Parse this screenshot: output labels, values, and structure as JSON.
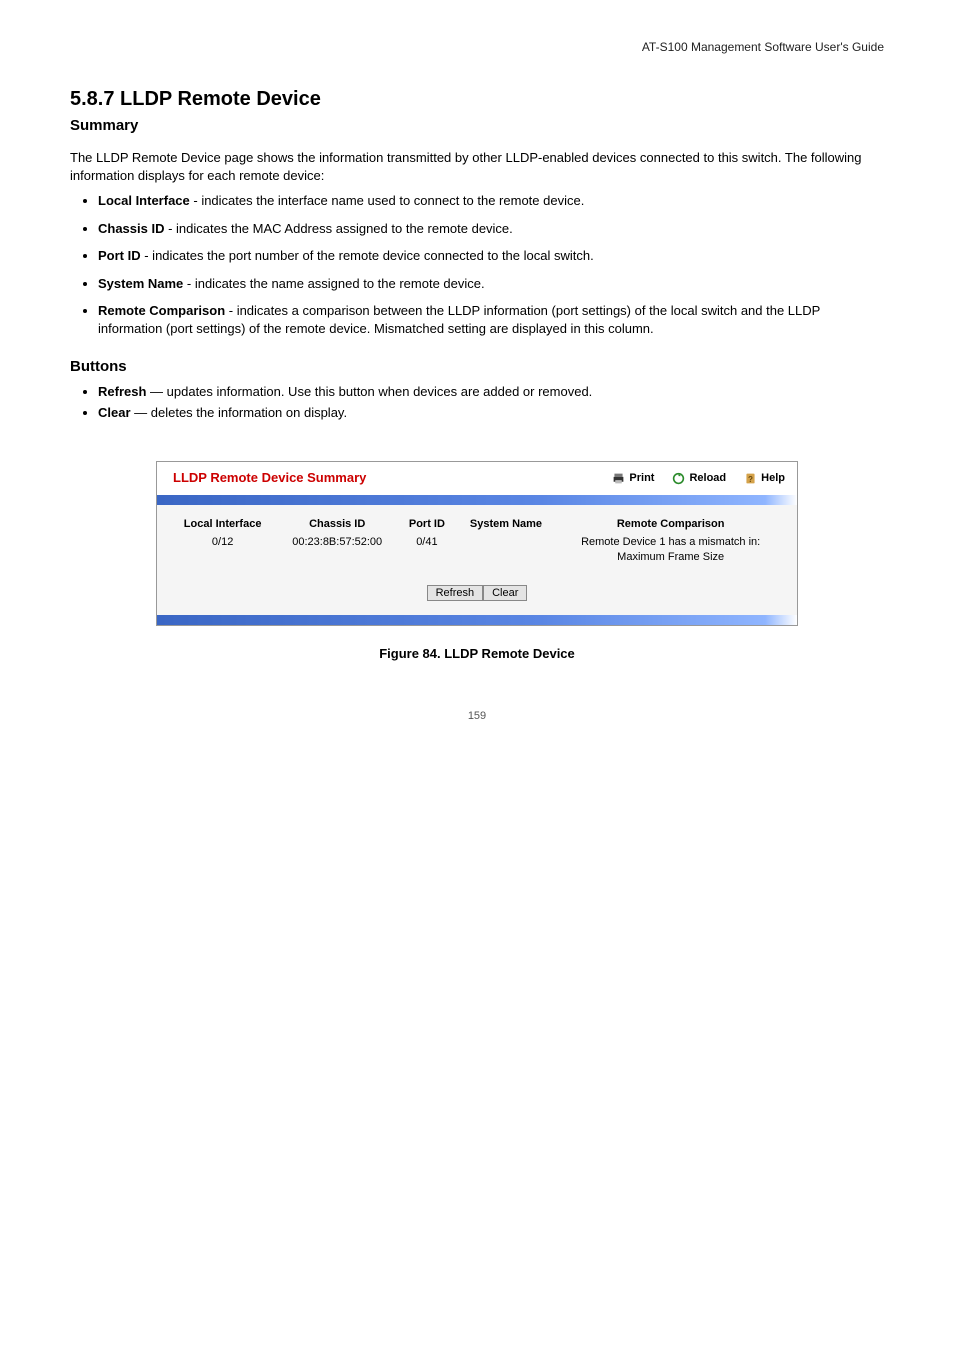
{
  "header": {
    "book_title": "AT-S100 Management Software User's Guide"
  },
  "section": {
    "number": "5.8.7 LLDP Remote Device",
    "subtitle": "Summary",
    "intro": "The LLDP Remote Device page shows the information transmitted by other LLDP-enabled devices connected to this switch. The following information displays for each remote device:",
    "fields": [
      {
        "name": "Local Interface",
        "desc": " - indicates the interface name used to connect to the remote device."
      },
      {
        "name": "Chassis ID",
        "desc": " - indicates the MAC Address assigned to the remote device."
      },
      {
        "name": "Port ID",
        "desc": " - indicates the port number of the remote device connected to the local switch."
      },
      {
        "name": "System Name",
        "desc": " - indicates the name assigned to the remote device."
      },
      {
        "name": "Remote Comparison",
        "desc": " - indicates a comparison between the LLDP information (port settings) of the local switch and the LLDP information (port settings) of the remote device. Mismatched setting are displayed in this column."
      }
    ]
  },
  "buttons_section": {
    "heading": "Buttons",
    "items": [
      {
        "name": "Refresh",
        "desc": " — updates information. Use this button when devices are added or removed."
      },
      {
        "name": "Clear",
        "desc": " — deletes the information on display."
      }
    ]
  },
  "screenshot": {
    "title": "LLDP Remote Device Summary",
    "actions": {
      "print": "Print",
      "reload": "Reload",
      "help": "Help"
    },
    "columns": {
      "c1": "Local Interface",
      "c2": "Chassis ID",
      "c3": "Port ID",
      "c4": "System Name",
      "c5": "Remote Comparison"
    },
    "row": {
      "local_interface": "0/12",
      "chassis_id": "00:23:8B:57:52:00",
      "port_id": "0/41",
      "system_name": "",
      "remote_comparison_line1": "Remote Device 1 has a mismatch in:",
      "remote_comparison_line2": "Maximum Frame Size"
    },
    "buttons": {
      "refresh": "Refresh",
      "clear": "Clear"
    }
  },
  "figure_caption": "Figure 84. LLDP Remote Device",
  "page_number": "159"
}
